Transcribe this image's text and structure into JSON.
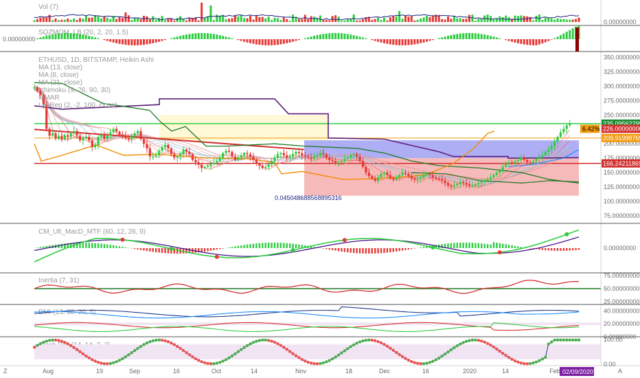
{
  "symbol_line": "ETHUSD, 1D, BITSTAMP, Heikin Ashi",
  "chart_data": {
    "type": "line",
    "title": "",
    "x_ticks": [
      "Aug",
      "19",
      "Sep",
      "16",
      "Oct",
      "14",
      "Nov",
      "18",
      "Dec",
      "16",
      "2020",
      "14",
      "Feb"
    ],
    "date_badge": "02/09/2020",
    "corner_left": "Z",
    "corner_right": "A",
    "panes": [
      {
        "id": "vol",
        "title": "Vol (7)",
        "y_ticks": [
          "0.00000000"
        ]
      },
      {
        "id": "sqz",
        "title": "SQZMOM_LB (20, 2, 20, 1.5)",
        "left_value": "0.00000000"
      },
      {
        "id": "price",
        "overlays": [
          "MA (13, close)",
          "MA (8, close)",
          "MA (21, close)",
          "Ichimoku (9, 26, 90, 30)",
          "MMAR",
          "Lin Reg (2, -2, 100, close)"
        ],
        "y_ticks": [
          "350.00000000",
          "325.00000000",
          "300.00000000",
          "275.00000000",
          "250.00000000",
          "225.00000000",
          "200.00000000",
          "175.00000000",
          "150.00000000",
          "125.00000000",
          "100.00000000",
          "75.00000000"
        ],
        "annotation": "0.045048688568895316",
        "price_tags": [
          {
            "text": "235.09562299",
            "color": "#1a8a2e"
          },
          {
            "text": "226.00000000",
            "color": "#d32f2f"
          },
          {
            "text": "6.42%",
            "color": "#f39c12"
          },
          {
            "text": "209.91998769",
            "color": "#f39c12"
          },
          {
            "text": "166.24211869",
            "color": "#d32f2f"
          }
        ],
        "levels": {
          "green": 235,
          "red": 166,
          "orange": 210
        },
        "close": [
          298,
          292,
          285,
          268,
          226,
          214,
          218,
          209,
          214,
          208,
          215,
          212,
          218,
          222,
          214,
          206,
          210,
          212,
          206,
          194,
          198,
          212,
          216,
          208,
          214,
          220,
          226,
          221,
          216,
          214,
          210,
          208,
          214,
          218,
          222,
          208,
          200,
          192,
          178,
          178,
          180,
          188,
          194,
          198,
          192,
          182,
          176,
          178,
          182,
          190,
          186,
          182,
          172,
          168,
          164,
          158,
          160,
          162,
          165,
          167,
          170,
          176,
          184,
          188,
          186,
          178,
          172,
          176,
          180,
          184,
          182,
          178,
          172,
          166,
          162,
          158,
          160,
          164,
          170,
          176,
          182,
          184,
          180,
          176,
          178,
          182,
          186,
          184,
          180,
          178,
          176,
          174,
          178,
          180,
          184,
          182,
          176,
          172,
          170,
          166,
          168,
          170,
          174,
          176,
          180,
          182,
          178,
          170,
          160,
          150,
          144,
          140,
          136,
          142,
          148,
          150,
          146,
          140,
          138,
          142,
          146,
          150,
          148,
          144,
          140,
          138,
          140,
          142,
          146,
          148,
          146,
          142,
          140,
          138,
          136,
          132,
          128,
          126,
          128,
          130,
          134,
          132,
          130,
          128,
          128,
          130,
          132,
          134,
          136,
          138,
          142,
          146,
          150,
          154,
          160,
          164,
          168,
          166,
          170,
          172,
          176,
          172,
          168,
          166,
          170,
          174,
          178,
          180,
          186,
          190,
          196,
          204,
          212,
          220,
          226,
          232,
          236
        ]
      },
      {
        "id": "macd",
        "title": "CM_Ult_MacD_MTF (60, 12, 26, 9)",
        "y_ticks": [
          "0.00000000"
        ]
      },
      {
        "id": "inertia",
        "title": "Inertia (7, 31)",
        "y_ticks": [
          "75.00000000",
          "50.00000000",
          "25.00000000"
        ]
      },
      {
        "id": "dmi",
        "title": "DMI (13, 30, 20, 5)",
        "y_ticks": [
          "40.00000000",
          "20.00000000",
          "0.00000000"
        ]
      },
      {
        "id": "stoch",
        "title": "Stoch RSI (14, 14, 3, 3)",
        "y_ticks": [
          "100.00",
          "0.00"
        ]
      }
    ]
  }
}
